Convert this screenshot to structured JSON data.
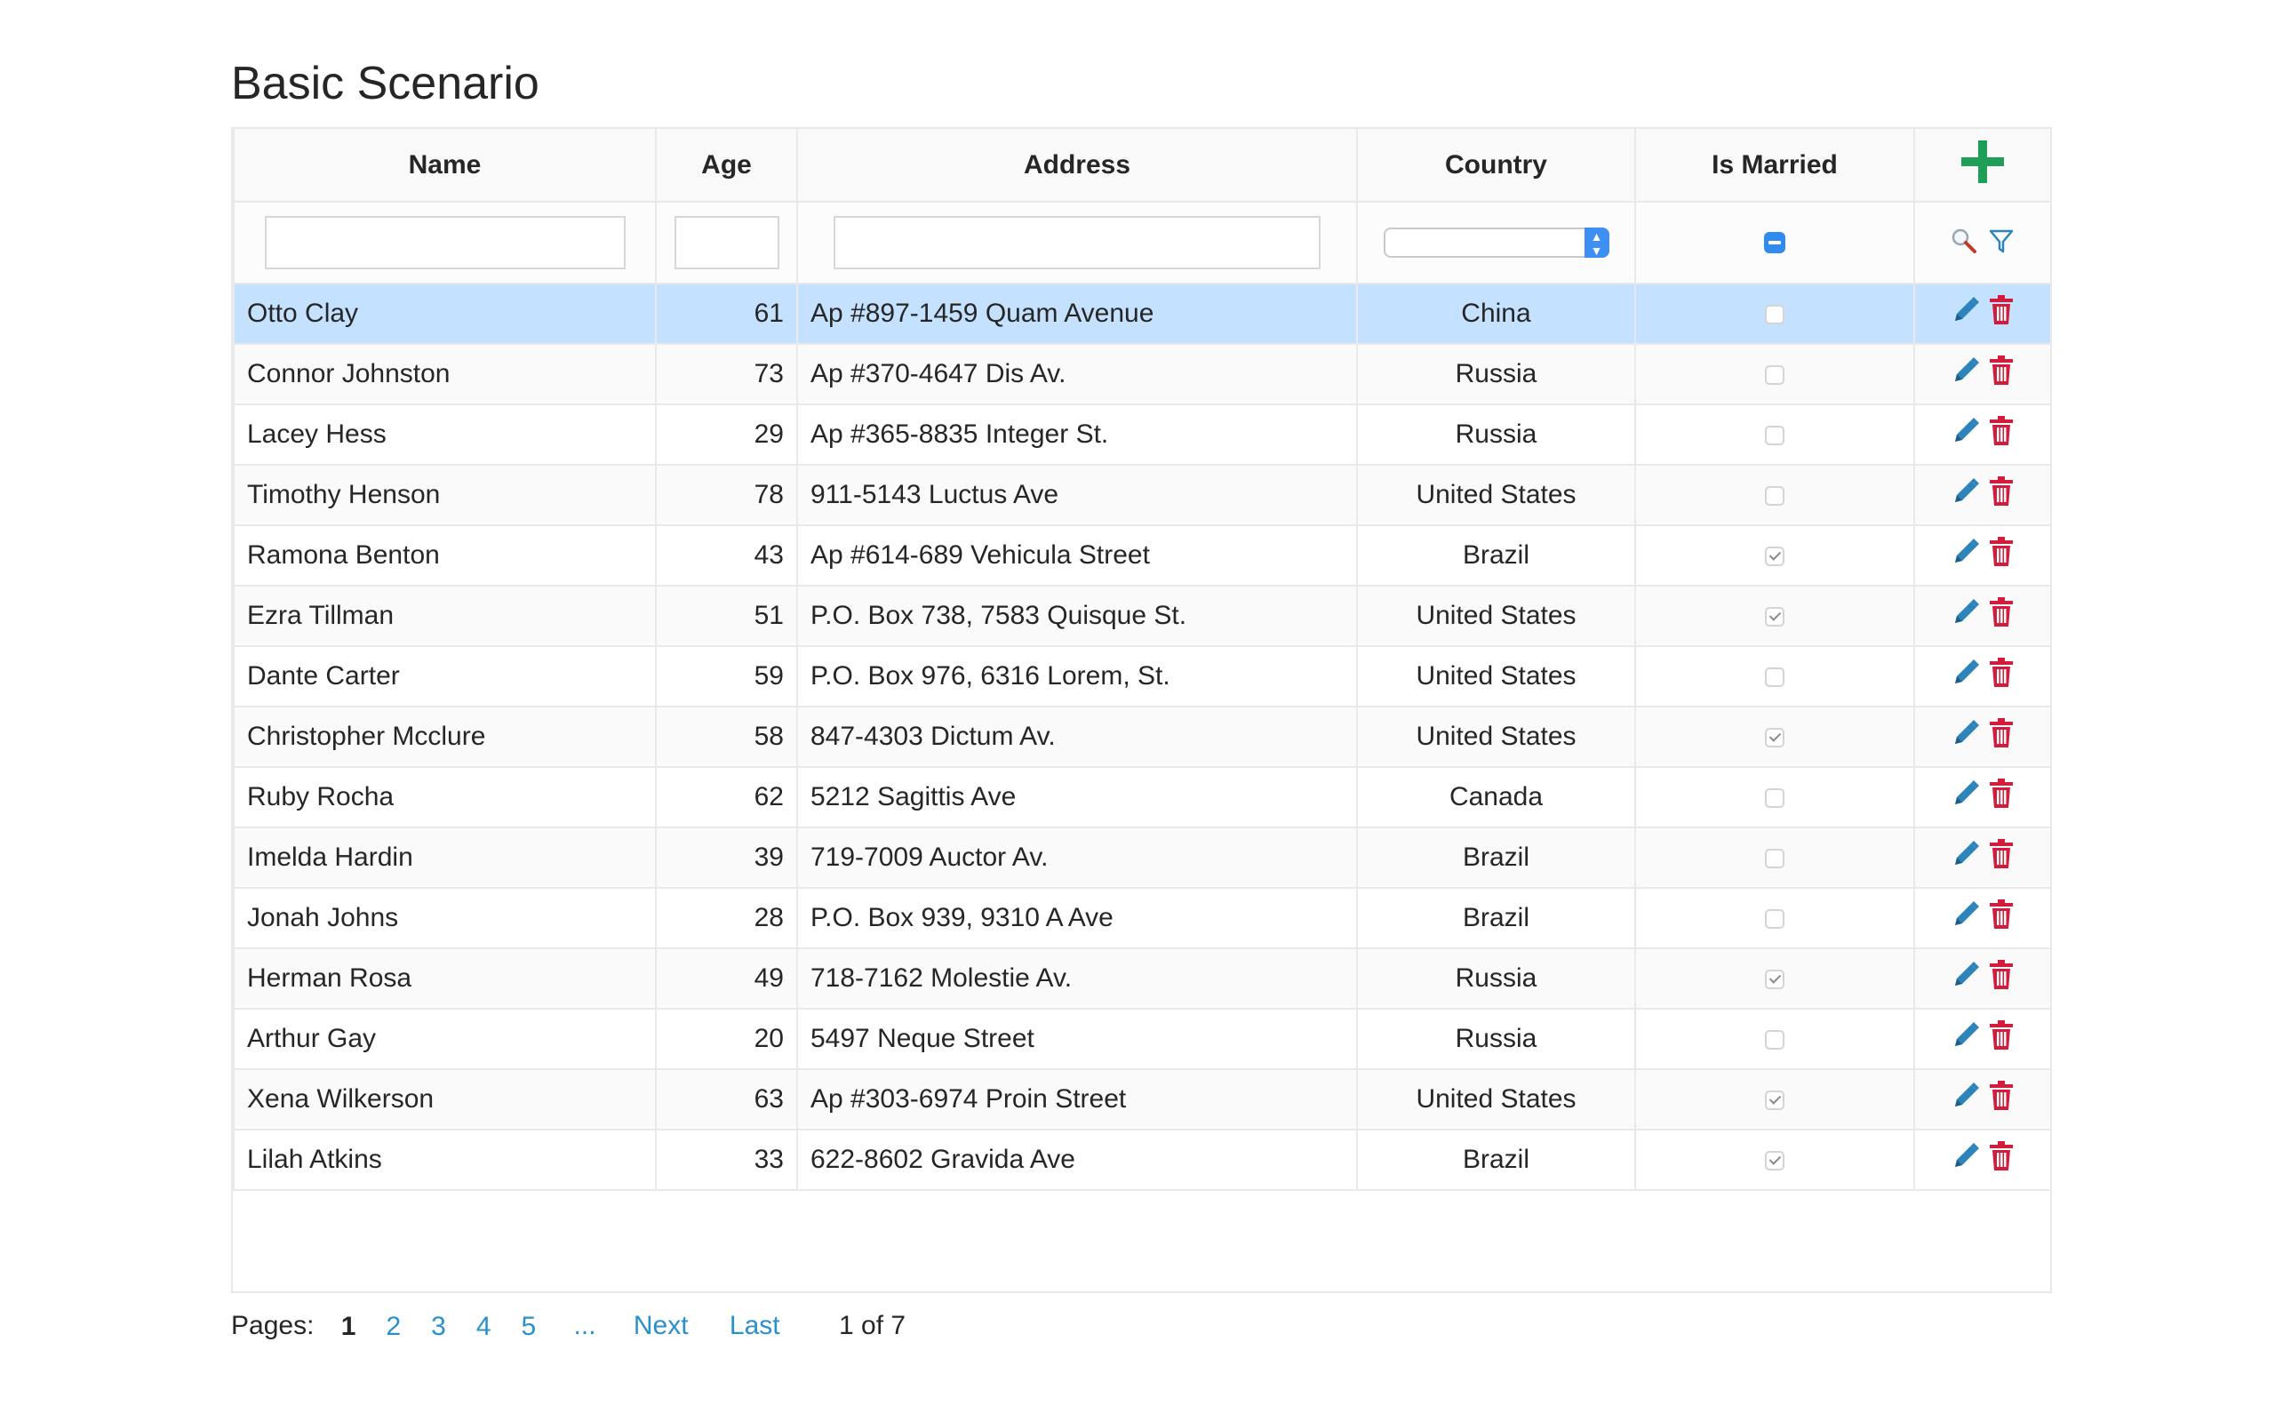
{
  "page": {
    "title": "Basic Scenario"
  },
  "columns": {
    "name": "Name",
    "age": "Age",
    "address": "Address",
    "country": "Country",
    "married": "Is Married"
  },
  "colors": {
    "add": "#1e9e57",
    "edit": "#2c84bb",
    "delete": "#d31c3b",
    "selected_row": "#c4e2ff",
    "link": "#2a90c9"
  },
  "filters": {
    "name": "",
    "age": "",
    "address": "",
    "country": "",
    "married_state": "indeterminate"
  },
  "icons": {
    "add": "plus-icon",
    "search": "search-icon",
    "filter": "filter-icon",
    "edit": "pencil-icon",
    "delete": "trash-icon"
  },
  "rows": [
    {
      "name": "Otto Clay",
      "age": "61",
      "address": "Ap #897-1459 Quam Avenue",
      "country": "China",
      "married": false
    },
    {
      "name": "Connor Johnston",
      "age": "73",
      "address": "Ap #370-4647 Dis Av.",
      "country": "Russia",
      "married": false
    },
    {
      "name": "Lacey Hess",
      "age": "29",
      "address": "Ap #365-8835 Integer St.",
      "country": "Russia",
      "married": false
    },
    {
      "name": "Timothy Henson",
      "age": "78",
      "address": "911-5143 Luctus Ave",
      "country": "United States",
      "married": false
    },
    {
      "name": "Ramona Benton",
      "age": "43",
      "address": "Ap #614-689 Vehicula Street",
      "country": "Brazil",
      "married": true
    },
    {
      "name": "Ezra Tillman",
      "age": "51",
      "address": "P.O. Box 738, 7583 Quisque St.",
      "country": "United States",
      "married": true
    },
    {
      "name": "Dante Carter",
      "age": "59",
      "address": "P.O. Box 976, 6316 Lorem, St.",
      "country": "United States",
      "married": false
    },
    {
      "name": "Christopher Mcclure",
      "age": "58",
      "address": "847-4303 Dictum Av.",
      "country": "United States",
      "married": true
    },
    {
      "name": "Ruby Rocha",
      "age": "62",
      "address": "5212 Sagittis Ave",
      "country": "Canada",
      "married": false
    },
    {
      "name": "Imelda Hardin",
      "age": "39",
      "address": "719-7009 Auctor Av.",
      "country": "Brazil",
      "married": false
    },
    {
      "name": "Jonah Johns",
      "age": "28",
      "address": "P.O. Box 939, 9310 A Ave",
      "country": "Brazil",
      "married": false
    },
    {
      "name": "Herman Rosa",
      "age": "49",
      "address": "718-7162 Molestie Av.",
      "country": "Russia",
      "married": true
    },
    {
      "name": "Arthur Gay",
      "age": "20",
      "address": "5497 Neque Street",
      "country": "Russia",
      "married": false
    },
    {
      "name": "Xena Wilkerson",
      "age": "63",
      "address": "Ap #303-6974 Proin Street",
      "country": "United States",
      "married": true
    },
    {
      "name": "Lilah Atkins",
      "age": "33",
      "address": "622-8602 Gravida Ave",
      "country": "Brazil",
      "married": true
    }
  ],
  "selected_row": 0,
  "pager": {
    "label": "Pages:",
    "pages": [
      "1",
      "2",
      "3",
      "4",
      "5"
    ],
    "current": "1",
    "ellipsis": "...",
    "next": "Next",
    "last": "Last",
    "info": "1 of 7"
  }
}
